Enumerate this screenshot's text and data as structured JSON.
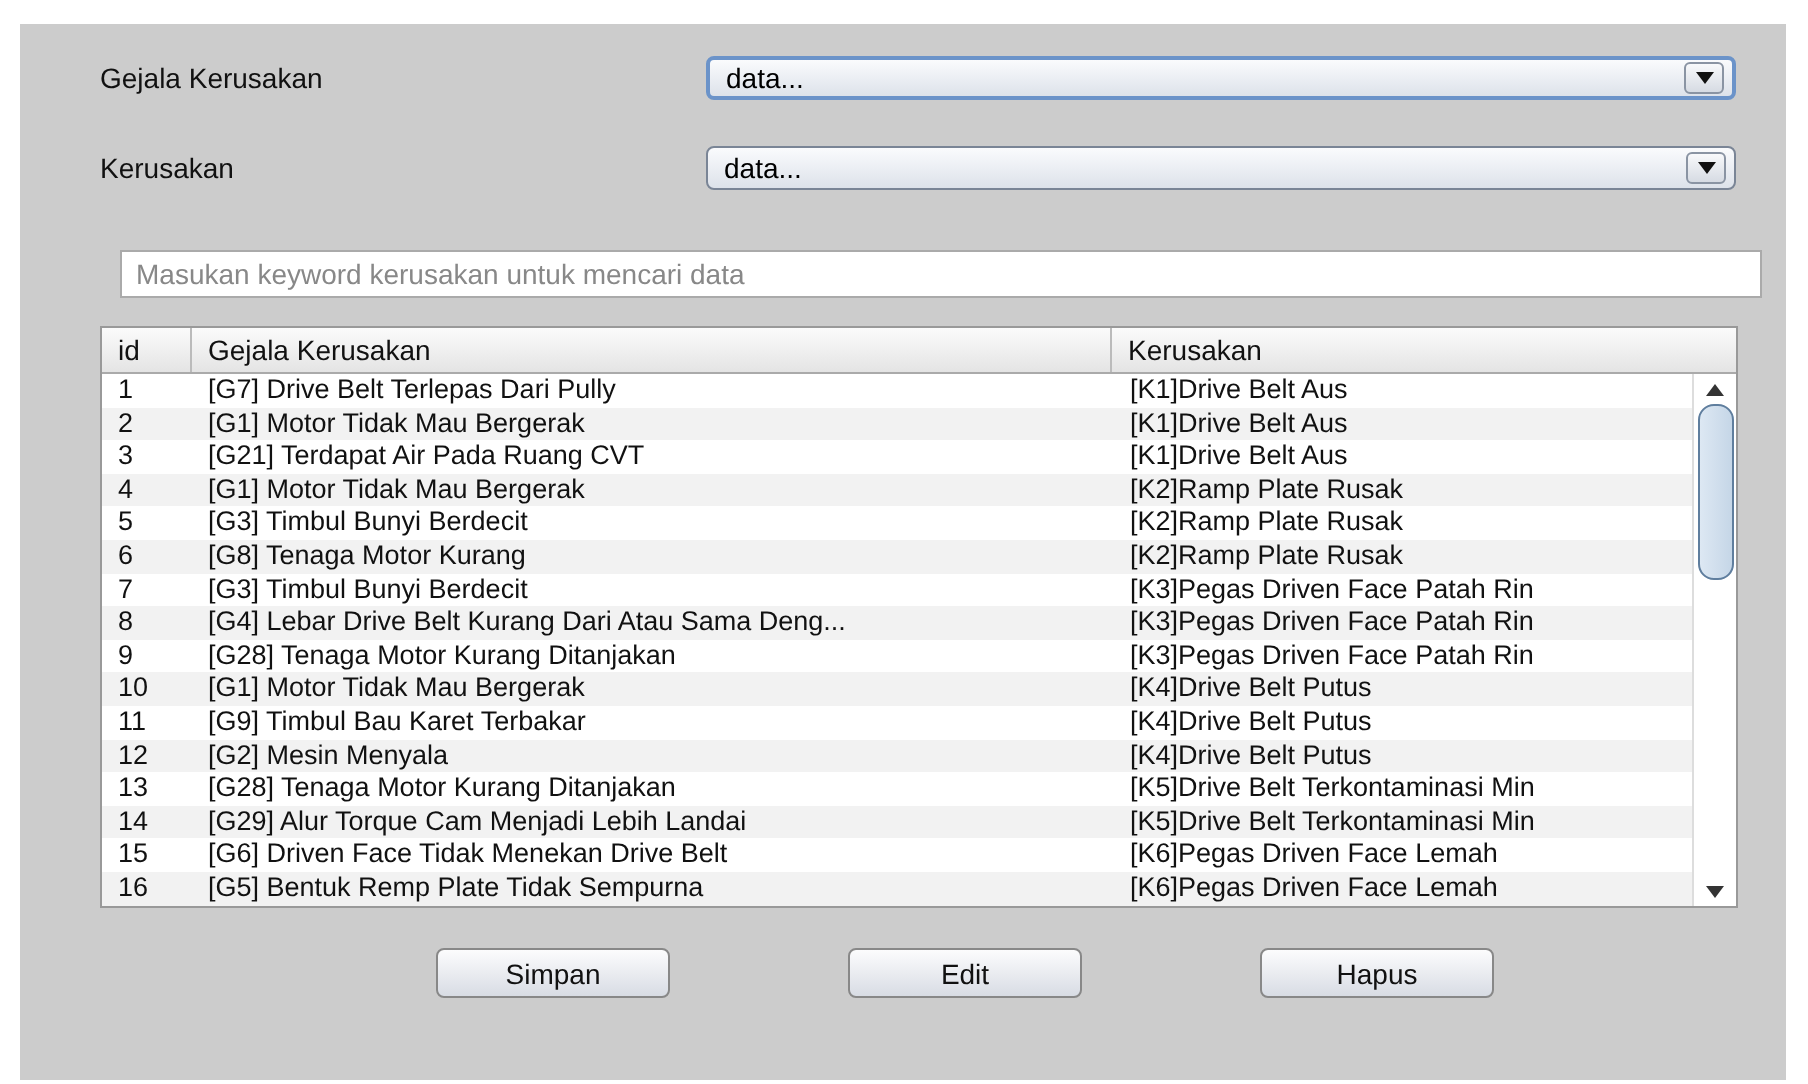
{
  "fields": [
    {
      "label": "Gejala Kerusakan",
      "value": "data...",
      "focused": true
    },
    {
      "label": "Kerusakan",
      "value": "data...",
      "focused": false
    }
  ],
  "search": {
    "placeholder": "Masukan keyword kerusakan untuk mencari data"
  },
  "table": {
    "columns": [
      "id",
      "Gejala Kerusakan",
      "Kerusakan"
    ],
    "rows": [
      [
        "1",
        "[G7] Drive Belt Terlepas Dari Pully",
        "[K1]Drive Belt Aus"
      ],
      [
        "2",
        "[G1] Motor Tidak Mau Bergerak",
        "[K1]Drive Belt Aus"
      ],
      [
        "3",
        "[G21] Terdapat Air Pada Ruang CVT",
        "[K1]Drive Belt Aus"
      ],
      [
        "4",
        "[G1] Motor Tidak Mau Bergerak",
        "[K2]Ramp Plate Rusak"
      ],
      [
        "5",
        "[G3] Timbul Bunyi Berdecit",
        "[K2]Ramp Plate Rusak"
      ],
      [
        "6",
        "[G8] Tenaga Motor Kurang",
        "[K2]Ramp Plate Rusak"
      ],
      [
        "7",
        "[G3] Timbul Bunyi Berdecit",
        "[K3]Pegas Driven Face Patah Rin"
      ],
      [
        "8",
        "[G4] Lebar Drive Belt Kurang Dari Atau Sama Deng...",
        "[K3]Pegas Driven Face Patah Rin"
      ],
      [
        "9",
        "[G28] Tenaga Motor Kurang Ditanjakan",
        "[K3]Pegas Driven Face Patah Rin"
      ],
      [
        "10",
        "[G1] Motor Tidak Mau Bergerak",
        "[K4]Drive Belt Putus"
      ],
      [
        "11",
        "[G9] Timbul Bau Karet Terbakar",
        "[K4]Drive Belt Putus"
      ],
      [
        "12",
        "[G2] Mesin Menyala",
        "[K4]Drive Belt Putus"
      ],
      [
        "13",
        "[G28] Tenaga Motor Kurang Ditanjakan",
        "[K5]Drive Belt Terkontaminasi Min"
      ],
      [
        "14",
        "[G29] Alur Torque Cam Menjadi Lebih Landai",
        "[K5]Drive Belt Terkontaminasi Min"
      ],
      [
        "15",
        "[G6] Driven Face Tidak Menekan Drive Belt",
        "[K6]Pegas Driven Face Lemah"
      ],
      [
        "16",
        "[G5] Bentuk Remp Plate Tidak Sempurna",
        "[K6]Pegas Driven Face Lemah"
      ]
    ]
  },
  "buttons": [
    "Simpan",
    "Edit",
    "Hapus"
  ]
}
